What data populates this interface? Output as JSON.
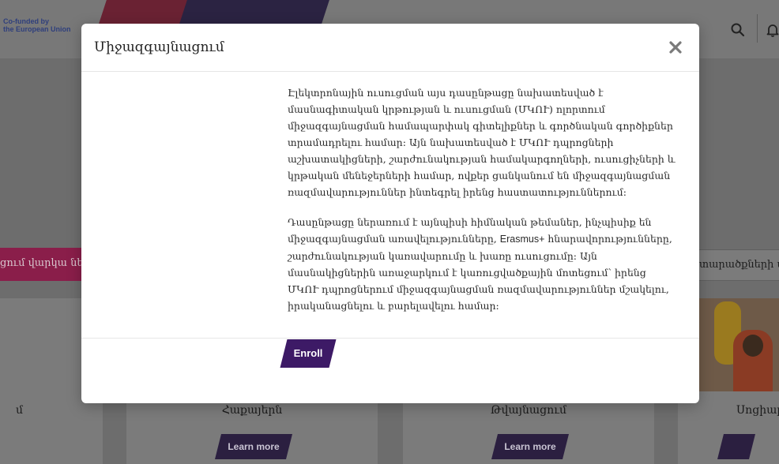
{
  "header": {
    "logo_line1": "Co-funded by",
    "logo_line2": "the European Union",
    "search_icon": "search-icon",
    "bell_icon": "bell-icon"
  },
  "background": {
    "left_button_label": "ցում վարկա նե",
    "right_tab_label": "տարածքների պ",
    "cards": [
      {
        "title": "մ"
      },
      {
        "title": "Հաքայերն",
        "learn_more": "Learn more"
      },
      {
        "title": "Թվայնացում",
        "learn_more": "Learn more"
      },
      {
        "title": "Սոցիալ",
        "learn_more": ""
      }
    ]
  },
  "modal": {
    "title": "Միջազգայնացում",
    "close_icon": "close-icon",
    "paragraph1": "Էլեկտրոնային ուսուցման այս դասընթացը նախատեսված է մասնագիտական կրթության և ուսուցման (ՄԿՈՒ) ոլորտում միջազգայնացման համապարփակ գիտելիքներ և գործնական գործիքներ տրամադրելու համար: Այն նախատեսված է ՄԿՈՒ դպրոցների աշխատակիցների, շարժունակության համակարգողների, ուսուցիչների և կրթական մենեջերների համար, ովքեր ցանկանում են միջազգայնացման ռազմավարություններ ինտեգրել իրենց հաստատություններում:",
    "paragraph2_part1": "Դասընթացը ներառում է այնպիսի հիմնական թեմաներ, ինչպիսիք են միջազգայնացման առավելությունները, ",
    "paragraph2_latin": "Erasmus+",
    "paragraph2_part2": " հնարավորությունները, շարժունակության կառավարումը և խառը ուսուցումը: Այն մասնակիցներին առաջարկում է կառուցվածքային մոտեցում՝ իրենց ՄԿՈՒ դպրոցներում միջազգայնացման ռազմավարություններ մշակելու, իրականացնելու և բարելավելու համար:",
    "enroll_label": "Enroll"
  },
  "colors": {
    "enroll_bg": "#3d1a66",
    "overlay": "#6d6d6d",
    "accent_pink": "#8a1e4a"
  }
}
